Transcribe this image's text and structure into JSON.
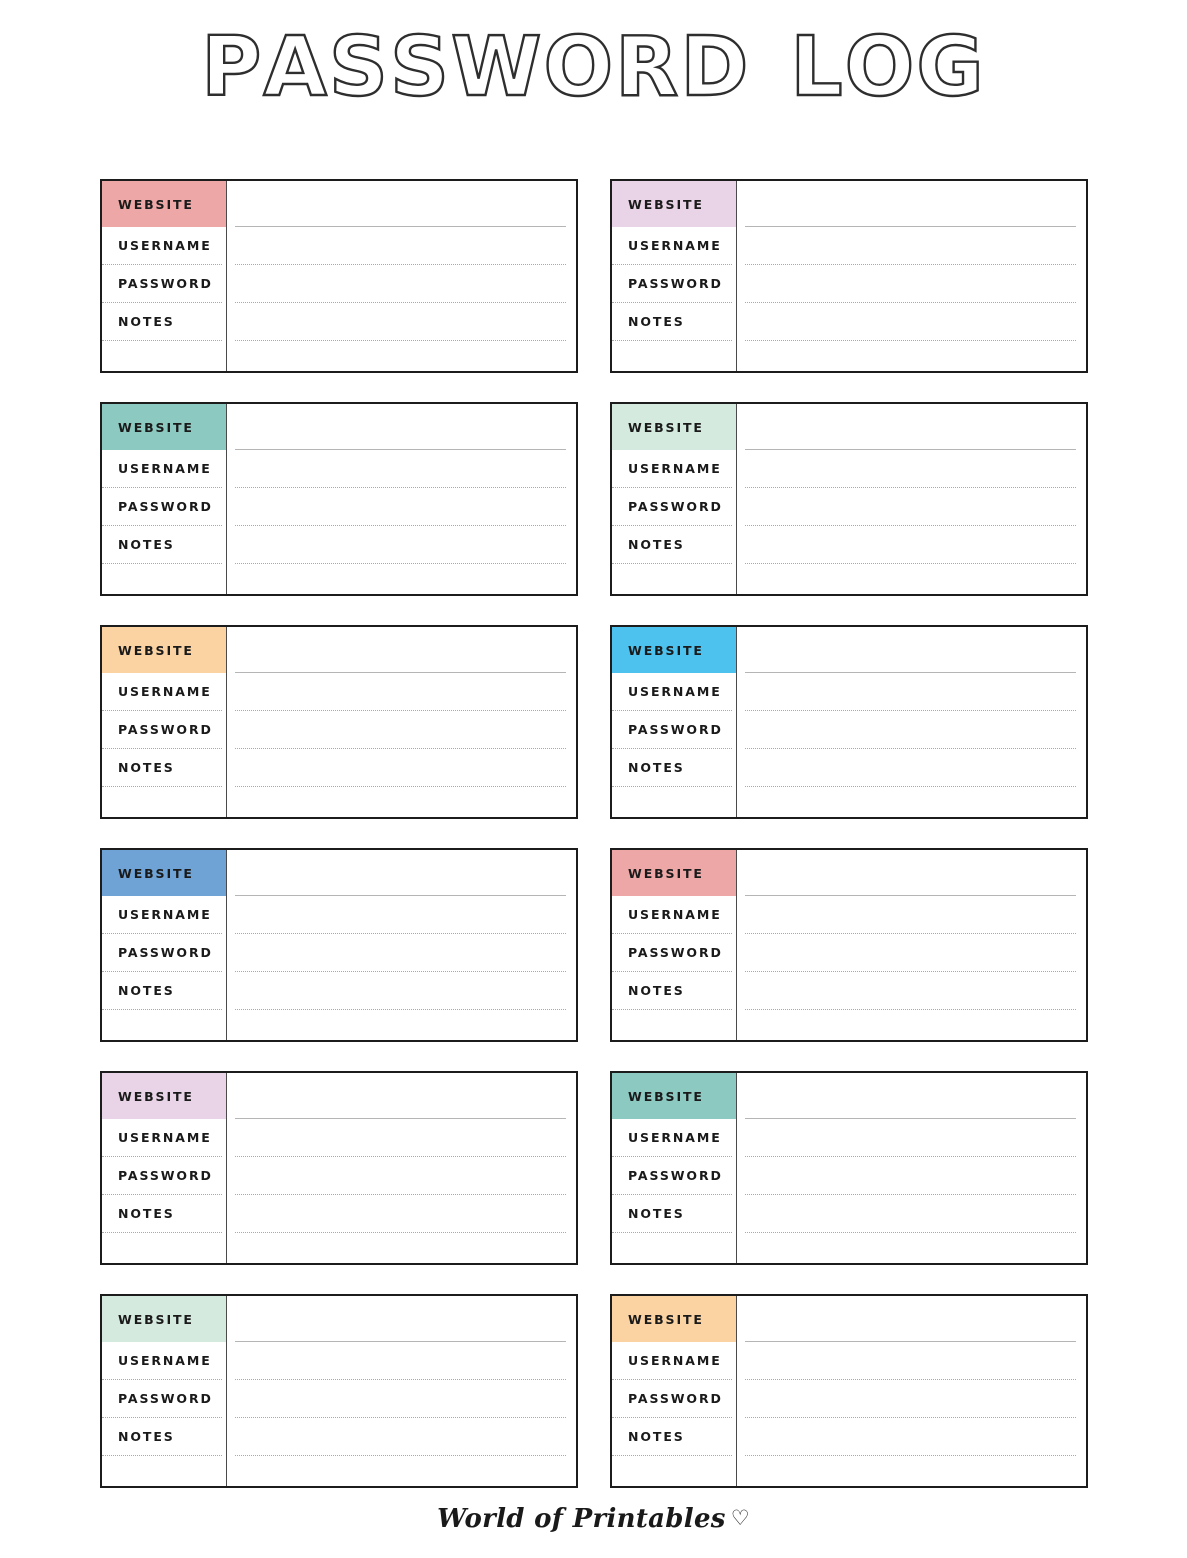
{
  "document": {
    "title": "PASSWORD LOG",
    "title_letters": [
      {
        "ch": "P",
        "color": "#efa0a0"
      },
      {
        "ch": "A",
        "color": "#e7cde3"
      },
      {
        "ch": "S",
        "color": "#88ccc2"
      },
      {
        "ch": "S",
        "color": "#e7cde3"
      },
      {
        "ch": "W",
        "color": "#d2e9dd"
      },
      {
        "ch": "O",
        "color": "#fbd4a4"
      },
      {
        "ch": "R",
        "color": "#efa0a0"
      },
      {
        "ch": "D",
        "color": "#4ec3ef"
      },
      {
        "ch": "L",
        "color": "#6fa3d6"
      },
      {
        "ch": "O",
        "color": "#efa0a0"
      },
      {
        "ch": "G",
        "color": "#e7cde3"
      }
    ]
  },
  "labels": {
    "website": "WEBSITE",
    "username": "USERNAME",
    "password": "PASSWORD",
    "notes": "NOTES"
  },
  "cards": [
    {
      "index": 1,
      "header_label": "WEBSITE",
      "header_color": "#eda7a7",
      "username": "",
      "password": "",
      "notes": "",
      "website": ""
    },
    {
      "index": 2,
      "header_label": "WEBSITE",
      "header_color": "#e9d3e6",
      "username": "",
      "password": "",
      "notes": "",
      "website": ""
    },
    {
      "index": 3,
      "header_label": "WEBSITE",
      "header_color": "#8cc9c1",
      "username": "",
      "password": "",
      "notes": "",
      "website": ""
    },
    {
      "index": 4,
      "header_label": "WEBSITE",
      "header_color": "#d4eade",
      "username": "",
      "password": "",
      "notes": "",
      "website": ""
    },
    {
      "index": 5,
      "header_label": "WEBSITE",
      "header_color": "#fbd3a2",
      "username": "",
      "password": "",
      "notes": "",
      "website": ""
    },
    {
      "index": 6,
      "header_label": "WEBSITE",
      "header_color": "#4ec2ee",
      "username": "",
      "password": "",
      "notes": "",
      "website": ""
    },
    {
      "index": 7,
      "header_label": "WEBSITE",
      "header_color": "#6fa3d6",
      "username": "",
      "password": "",
      "notes": "",
      "website": ""
    },
    {
      "index": 8,
      "header_label": "WEBSITE",
      "header_color": "#eda7a7",
      "username": "",
      "password": "",
      "notes": "",
      "website": ""
    },
    {
      "index": 9,
      "header_label": "WEBSITE",
      "header_color": "#e9d3e6",
      "username": "",
      "password": "",
      "notes": "",
      "website": ""
    },
    {
      "index": 10,
      "header_label": "WEBSITE",
      "header_color": "#8cc9c1",
      "username": "",
      "password": "",
      "notes": "",
      "website": ""
    },
    {
      "index": 11,
      "header_label": "WEBSITE",
      "header_color": "#d4eade",
      "username": "",
      "password": "",
      "notes": "",
      "website": ""
    },
    {
      "index": 12,
      "header_label": "WEBSITE",
      "header_color": "#fbd3a2",
      "username": "",
      "password": "",
      "notes": "",
      "website": ""
    }
  ],
  "footer": {
    "brand": "World of Printables",
    "heart_icon": "♡"
  }
}
